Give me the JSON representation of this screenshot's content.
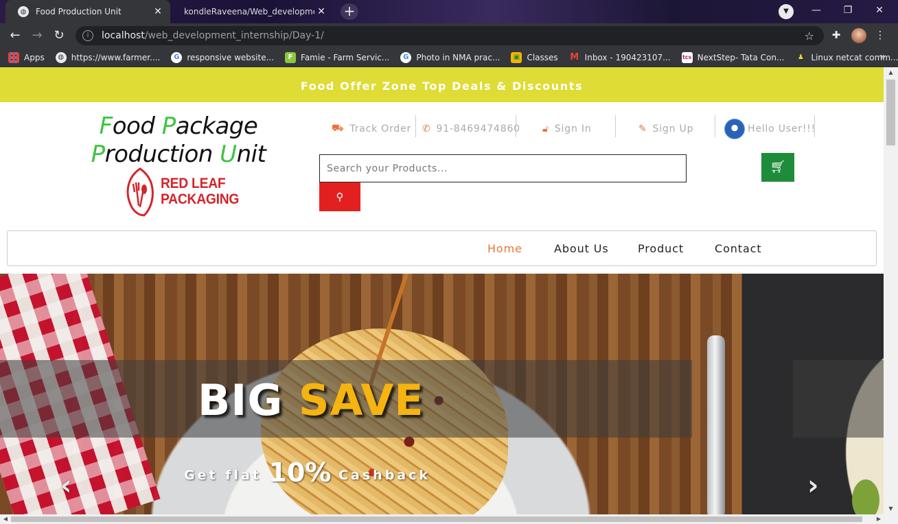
{
  "browser": {
    "tabs": [
      {
        "title": "Food Production Unit",
        "active": true
      },
      {
        "title": "kondleRaveena/Web_developme",
        "active": false
      }
    ],
    "url_host": "localhost",
    "url_path": "/web_development_internship/Day-1/",
    "bookmarks": [
      {
        "label": "Apps",
        "icon": "apps-grid-icon",
        "color": "#e94235"
      },
      {
        "label": "https://www.farmer....",
        "icon": "globe-icon",
        "color": "#e8eaed"
      },
      {
        "label": "responsive website...",
        "icon": "google-icon",
        "color": "#ffffff"
      },
      {
        "label": "Famie - Farm Servic...",
        "icon": "famie-f-icon",
        "color": "#8cc63f"
      },
      {
        "label": "Photo in NMA prac...",
        "icon": "google-icon",
        "color": "#ffffff"
      },
      {
        "label": "Classes",
        "icon": "classroom-icon",
        "color": "#f4b400"
      },
      {
        "label": "Inbox - 190423107...",
        "icon": "gmail-icon",
        "color": "#ffffff"
      },
      {
        "label": "NextStep- Tata Con...",
        "icon": "tcs-icon",
        "color": "#ffffff"
      },
      {
        "label": "Linux netcat comm...",
        "icon": "linux-tux-icon",
        "color": "#f4d03f"
      }
    ]
  },
  "page": {
    "offer_bar": "Food Offer Zone Top Deals & Discounts",
    "brand": {
      "line1": [
        {
          "t": "F",
          "g": true
        },
        {
          "t": "ood ",
          "g": false
        },
        {
          "t": "P",
          "g": true
        },
        {
          "t": "ackage",
          "g": false
        }
      ],
      "line2": [
        {
          "t": "P",
          "g": true
        },
        {
          "t": "roduction ",
          "g": false
        },
        {
          "t": "U",
          "g": true
        },
        {
          "t": "nit",
          "g": false
        }
      ]
    },
    "logo_line1": "RED LEAF",
    "logo_line2": "PACKAGING",
    "top_nav": {
      "track_order": "Track Order",
      "phone": "91-8469474860",
      "sign_in": "Sign In",
      "sign_up": "Sign Up",
      "hello": "Hello User!!!"
    },
    "search_placeholder": "Search your Products...",
    "main_nav": {
      "home": "Home",
      "about": "About Us",
      "product": "Product",
      "contact": "Contact"
    },
    "hero": {
      "big": "BIG",
      "save": "SAVE",
      "get_flat": "Get flat",
      "percent": "10%",
      "cashback": "Cashback"
    },
    "colors": {
      "offer_bar": "#dedc35",
      "brand_green": "#3ec43e",
      "search_button": "#e32020",
      "cart_button": "#1f8c3b",
      "active_nav": "#e8743b",
      "save_yellow": "#f6b411"
    }
  }
}
